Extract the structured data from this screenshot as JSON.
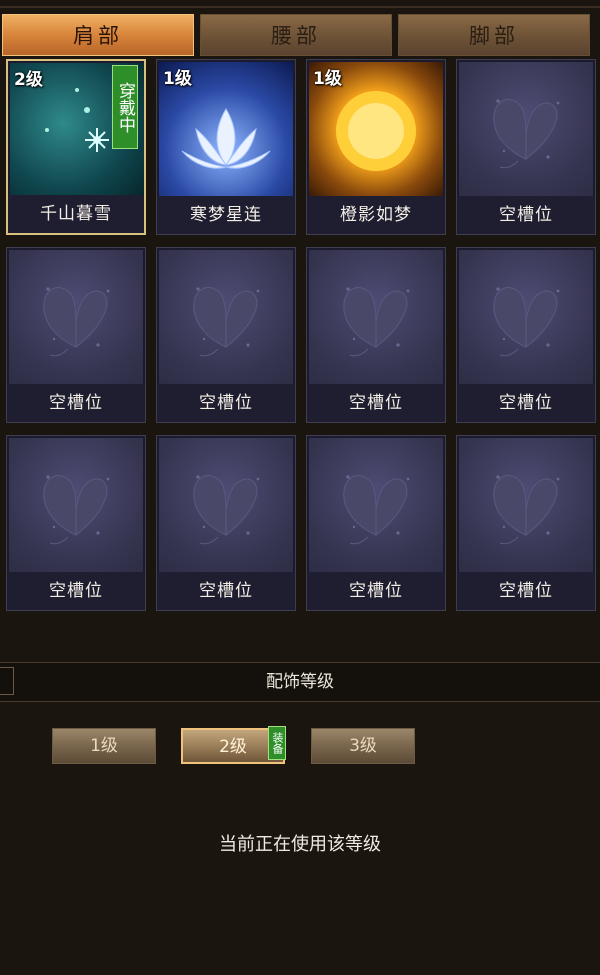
{
  "tabs": [
    {
      "label": "肩部",
      "active": true
    },
    {
      "label": "腰部",
      "active": false
    },
    {
      "label": "脚部",
      "active": false
    }
  ],
  "items": [
    {
      "name": "千山暮雪",
      "level": "2级",
      "badge": "穿戴中",
      "art": "snow",
      "selected": true
    },
    {
      "name": "寒梦星连",
      "level": "1级",
      "badge": "",
      "art": "lotus",
      "selected": false
    },
    {
      "name": "橙影如梦",
      "level": "1级",
      "badge": "",
      "art": "sun",
      "selected": false
    },
    {
      "name": "空槽位",
      "level": "",
      "badge": "",
      "art": "empty",
      "selected": false
    },
    {
      "name": "空槽位",
      "level": "",
      "badge": "",
      "art": "empty",
      "selected": false
    },
    {
      "name": "空槽位",
      "level": "",
      "badge": "",
      "art": "empty",
      "selected": false
    },
    {
      "name": "空槽位",
      "level": "",
      "badge": "",
      "art": "empty",
      "selected": false
    },
    {
      "name": "空槽位",
      "level": "",
      "badge": "",
      "art": "empty",
      "selected": false
    },
    {
      "name": "空槽位",
      "level": "",
      "badge": "",
      "art": "empty",
      "selected": false
    },
    {
      "name": "空槽位",
      "level": "",
      "badge": "",
      "art": "empty",
      "selected": false
    },
    {
      "name": "空槽位",
      "level": "",
      "badge": "",
      "art": "empty",
      "selected": false
    },
    {
      "name": "空槽位",
      "level": "",
      "badge": "",
      "art": "empty",
      "selected": false
    }
  ],
  "level_panel": {
    "title": "配饰等级",
    "buttons": [
      "1级",
      "2级",
      "3级"
    ],
    "active_index": 1,
    "equipped_badge": "装备",
    "status_text": "当前正在使用该等级"
  }
}
